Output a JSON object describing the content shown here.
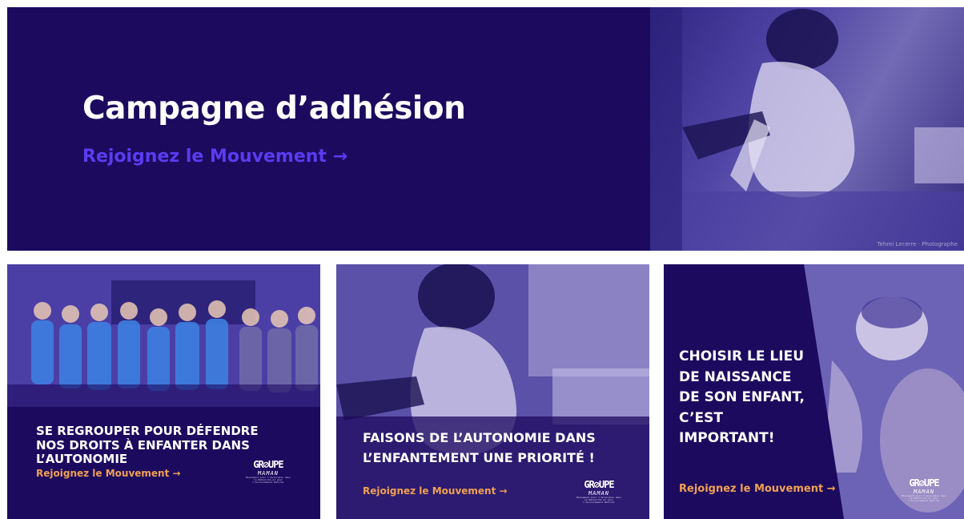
{
  "banner": {
    "title": "Campagne d’adhésion",
    "link": "Rejoignez le Mouvement →",
    "photo_credit": "Tehrei Lecerre · Photographe"
  },
  "cards": [
    {
      "lines": [
        "SE REGROUPER POUR DÉFENDRE",
        "NOS DROITS À ENFANTER DANS",
        "L’AUTONOMIE"
      ],
      "link": "Rejoignez  le Mouvement →",
      "logo": {
        "main": "GR⊘UPE",
        "sub": "MAMAN",
        "tagline": "Mouvement pour l’Autonomie dans la Maternité et pour l’Accouchement Naturel"
      }
    },
    {
      "lines": [
        "FAISONS DE L’AUTONOMIE DANS",
        "L’ENFANTEMENT UNE PRIORITÉ !"
      ],
      "link": "Rejoignez  le Mouvement →",
      "logo": {
        "main": "GR⊘UPE",
        "sub": "MAMAN",
        "tagline": "Mouvement pour l’Autonomie dans la Maternité et pour l’Accouchement Naturel"
      }
    },
    {
      "lines": [
        "CHOISIR LE LIEU",
        "DE NAISSANCE",
        "DE SON ENFANT,",
        "C’EST",
        "IMPORTANT!"
      ],
      "link": "Rejoignez le Mouvement →",
      "logo": {
        "main": "GR⊘UPE",
        "sub": "MAMAN",
        "tagline": "Mouvement pour l’Autonomie dans la Maternité et pour l’Accouchement Naturel"
      }
    }
  ],
  "colors": {
    "navy": "#1c0a5f",
    "link_purple": "#5a3cf0",
    "link_orange": "#f0a050",
    "photo_tint": "#3e3395"
  }
}
